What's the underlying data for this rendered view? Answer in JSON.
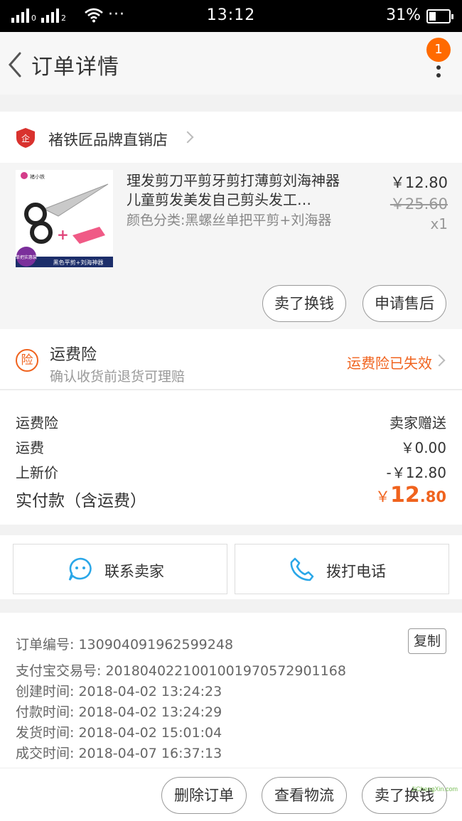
{
  "status_bar": {
    "time": "13:12",
    "battery": "31%",
    "sim1": "0",
    "sim2": "2",
    "dots": "···"
  },
  "header": {
    "title": "订单详情",
    "badge_count": "1"
  },
  "shop": {
    "logo_text": "企",
    "name": "褚铁匠品牌直销店"
  },
  "product": {
    "title": "理发剪刀平剪牙剪打薄剪刘海神器儿童剪发美发自己剪头发工…",
    "sku": "颜色分类:黑螺丝单把平剪+刘海器",
    "price": "￥12.80",
    "original_price": "￥25.60",
    "quantity": "x1",
    "image_brand": "褚小铁",
    "image_corner": "单把实惠装",
    "image_caption": "黑色平剪+刘海神器",
    "actions": [
      "卖了换钱",
      "申请售后"
    ]
  },
  "insurance": {
    "icon_text": "险",
    "title": "运费险",
    "subtitle": "确认收货前退货可理赔",
    "status": "运费险已失效"
  },
  "fees": {
    "rows": [
      {
        "label": "运费险",
        "value": "卖家赠送"
      },
      {
        "label": "运费",
        "value": "￥0.00"
      },
      {
        "label": "上新价",
        "value": "-￥12.80"
      }
    ],
    "total_label": "实付款（含运费）",
    "total_currency": "￥",
    "total_int": "12",
    "total_dec": ".80"
  },
  "contact": {
    "seller": "联系卖家",
    "phone": "拨打电话"
  },
  "order_info": {
    "order_no": "订单编号: 1309040919625992​48",
    "alipay_no": "支付宝交易号: 2018040221001001970572901168",
    "created": "创建时间: 2018-04-02 13:24:23",
    "paid": "付款时间: 2018-04-02 13:24:29",
    "shipped": "发货时间: 2018-04-02 15:01:04",
    "completed": "成交时间: 2018-04-07 16:37:13",
    "copy_label": "复制"
  },
  "bottom_actions": [
    "删除订单",
    "查看物流",
    "卖了换钱"
  ],
  "watermark": "JiChengXin.com",
  "colors": {
    "accent": "#f0631e",
    "badge": "#ff6a00",
    "contact_icon": "#2aa7e8"
  }
}
